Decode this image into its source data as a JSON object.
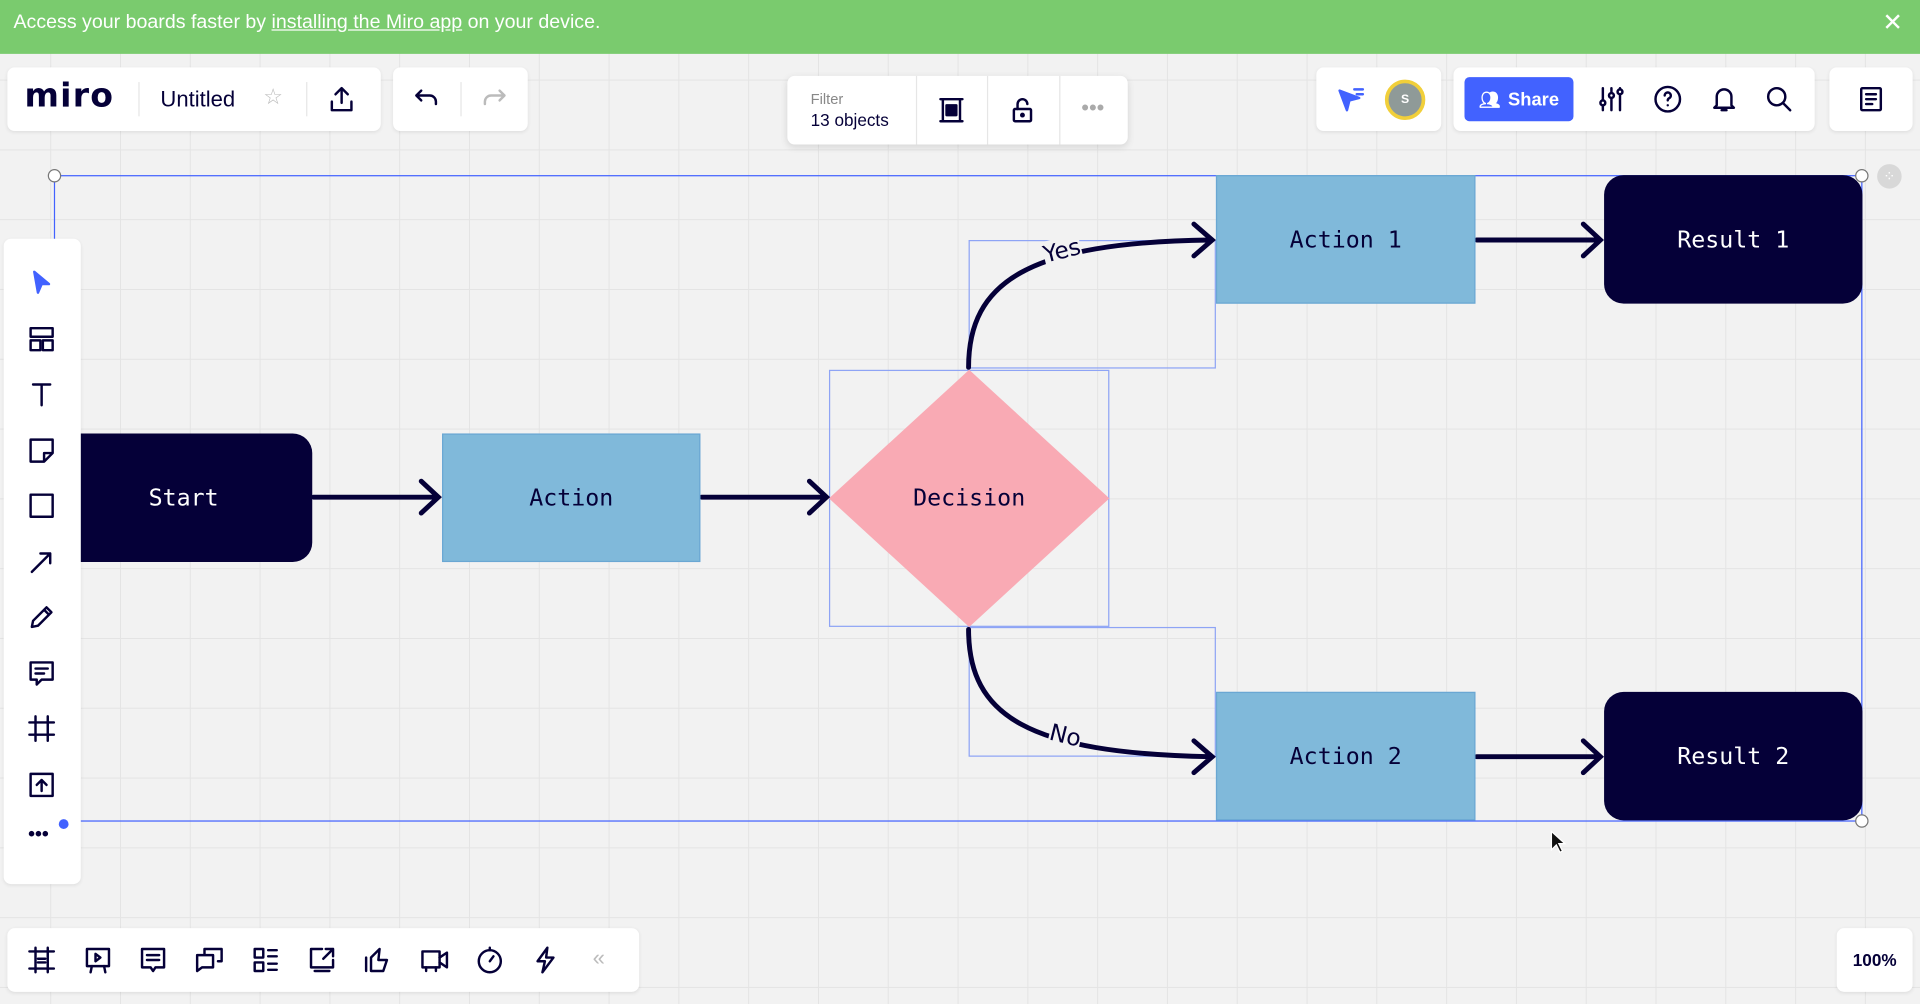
{
  "banner": {
    "text_before": "Access your boards faster by ",
    "link": "installing the Miro app",
    "text_after": " on your device."
  },
  "header": {
    "logo": "miro",
    "board_title": "Untitled"
  },
  "filter": {
    "label": "Filter",
    "count": "13 objects"
  },
  "share": {
    "label": "Share"
  },
  "avatar": {
    "initial": "S"
  },
  "zoom": {
    "level": "100%"
  },
  "colors": {
    "banner": "#7acb6e",
    "accent": "#4262ff",
    "dark_shape": "#050038",
    "action_shape": "#80b9da",
    "decision_shape": "#f9aab4"
  },
  "flow": {
    "start": "Start",
    "action": "Action",
    "decision": "Decision",
    "action1": "Action 1",
    "action2": "Action 2",
    "result1": "Result 1",
    "result2": "Result 2",
    "yes": "Yes",
    "no": "No"
  },
  "left_toolbar": [
    "select-icon",
    "templates-icon",
    "text-icon",
    "sticky-note-icon",
    "shape-icon",
    "arrow-icon",
    "pen-icon",
    "comment-icon",
    "frame-icon",
    "upload-icon",
    "more-icon"
  ],
  "bottom_toolbar": [
    "frames-icon",
    "presentation-icon",
    "comments-icon",
    "chat-icon",
    "cards-icon",
    "share-screen-icon",
    "voting-icon",
    "video-icon",
    "timer-icon",
    "lightning-icon",
    "collapse-icon"
  ]
}
